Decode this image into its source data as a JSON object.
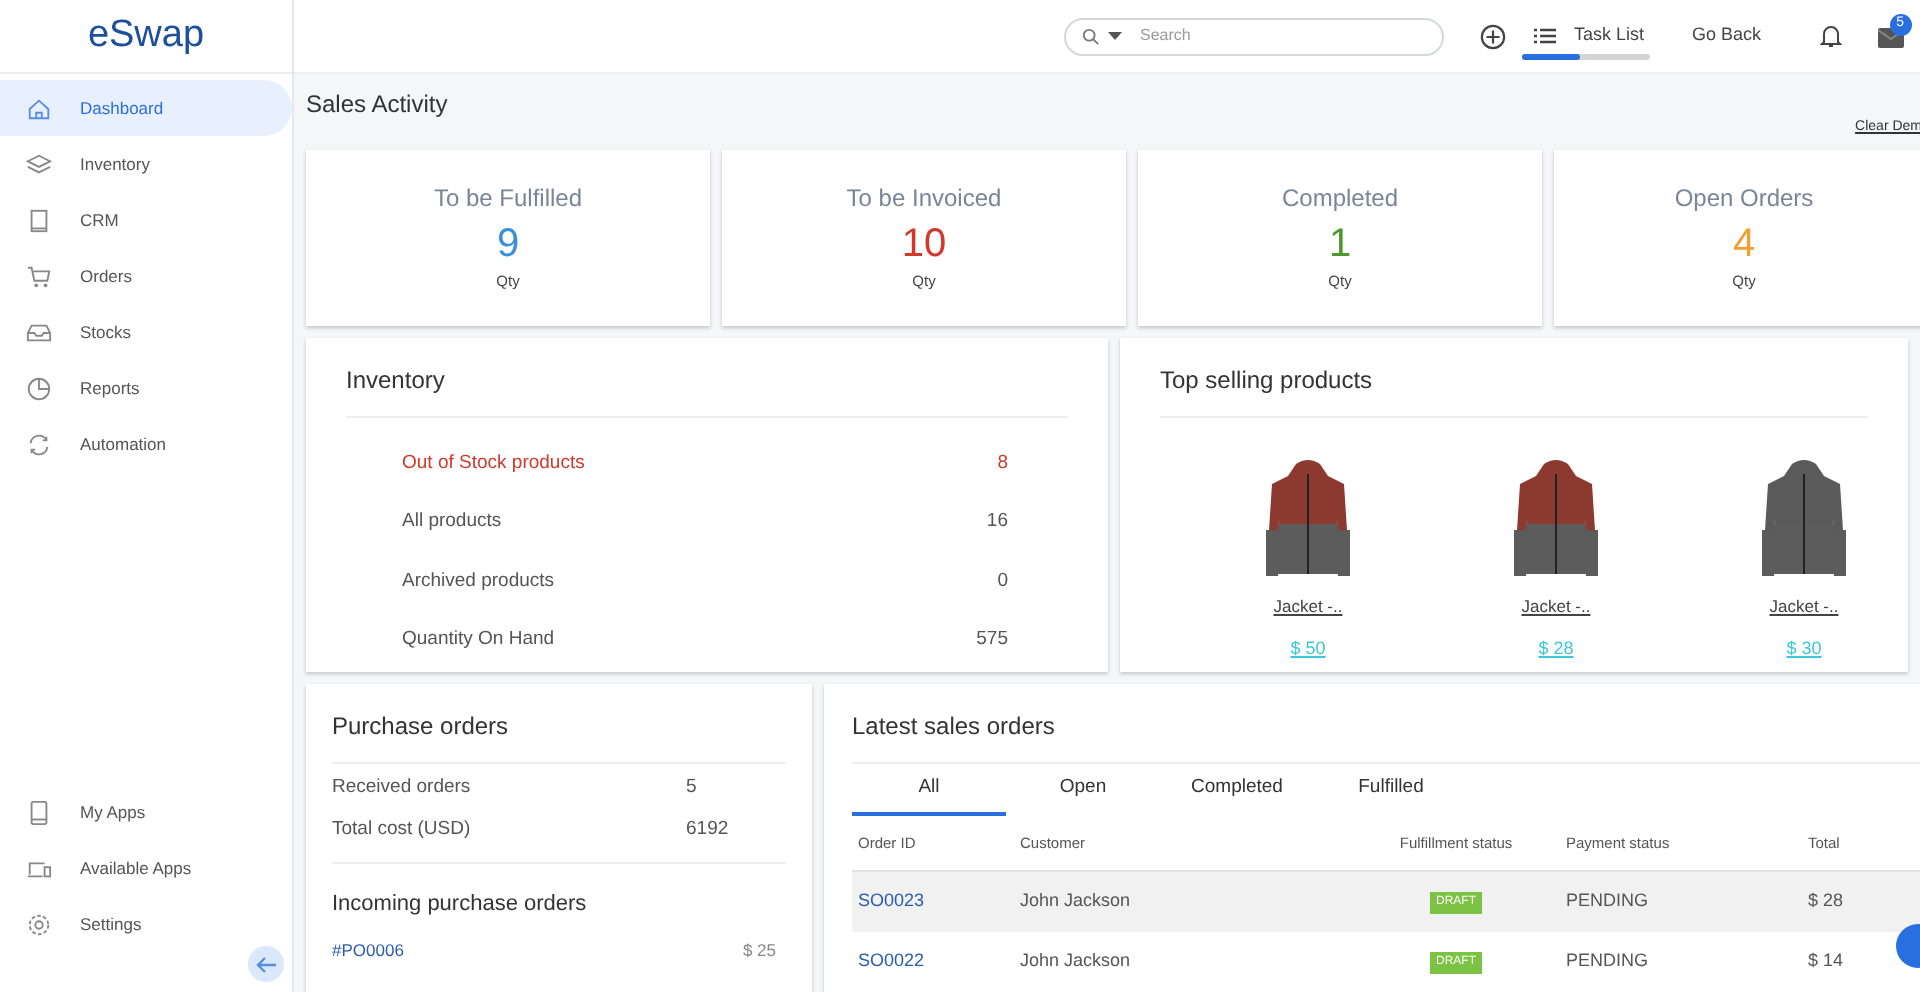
{
  "logo": "eSwap",
  "sidebar": {
    "items": [
      {
        "label": "Dashboard",
        "selected": true
      },
      {
        "label": "Inventory",
        "selected": false
      },
      {
        "label": "CRM",
        "selected": false
      },
      {
        "label": "Orders",
        "selected": false
      },
      {
        "label": "Stocks",
        "selected": false
      },
      {
        "label": "Reports",
        "selected": false
      },
      {
        "label": "Automation",
        "selected": false
      }
    ],
    "bottom_items": [
      {
        "label": "My Apps"
      },
      {
        "label": "Available Apps"
      },
      {
        "label": "Settings"
      }
    ]
  },
  "header": {
    "search": {
      "placeholder": "Search"
    },
    "task_list": {
      "label": "Task List",
      "level": 0.45
    },
    "go_back": "Go Back",
    "mail_badge": "5"
  },
  "page_title": "Sales Activity",
  "clear_demo": "Clear Dem",
  "stats": [
    {
      "title": "To be Fulfilled",
      "value": "9",
      "unit": "Qty",
      "color": "#3a8fd9"
    },
    {
      "title": "To be Invoiced",
      "value": "10",
      "unit": "Qty",
      "color": "#d0392b"
    },
    {
      "title": "Completed",
      "value": "1",
      "unit": "Qty",
      "color": "#4a9a2a"
    },
    {
      "title": "Open Orders",
      "value": "4",
      "unit": "Qty",
      "color": "#f0a030"
    }
  ],
  "inventory": {
    "title": "Inventory",
    "rows": [
      {
        "label": "Out of Stock products",
        "value": "8",
        "alert": true
      },
      {
        "label": "All products",
        "value": "16",
        "alert": false
      },
      {
        "label": "Archived products",
        "value": "0",
        "alert": false
      },
      {
        "label": "Quantity On Hand",
        "value": "575",
        "alert": false
      }
    ]
  },
  "top_selling": {
    "title": "Top selling products",
    "products": [
      {
        "name": "Jacket -..",
        "price": "$ 50",
        "color": "#8c3a30"
      },
      {
        "name": "Jacket -..",
        "price": "$ 28",
        "color": "#8c3a30"
      },
      {
        "name": "Jacket -..",
        "price": "$ 30",
        "color": "#5a5a5a"
      }
    ]
  },
  "purchase_orders": {
    "title": "Purchase orders",
    "rows": [
      {
        "label": "Received orders",
        "value": "5"
      },
      {
        "label": "Total cost (USD)",
        "value": "6192"
      }
    ],
    "incoming_title": "Incoming purchase orders",
    "incoming": [
      {
        "id": "#PO0006",
        "amount": "$ 25"
      }
    ]
  },
  "latest_sales": {
    "title": "Latest sales orders",
    "tabs": [
      {
        "label": "All",
        "selected": true
      },
      {
        "label": "Open",
        "selected": false
      },
      {
        "label": "Completed",
        "selected": false
      },
      {
        "label": "Fulfilled",
        "selected": false
      }
    ],
    "columns": [
      "Order ID",
      "Customer",
      "Fulfillment status",
      "Payment status",
      "Total"
    ],
    "rows": [
      {
        "id": "SO0023",
        "customer": "John Jackson",
        "fulfillment": "DRAFT",
        "payment": "PENDING",
        "total": "$ 28",
        "selected": true
      },
      {
        "id": "SO0022",
        "customer": "John Jackson",
        "fulfillment": "DRAFT",
        "payment": "PENDING",
        "total": "$ 14",
        "selected": false
      }
    ]
  }
}
